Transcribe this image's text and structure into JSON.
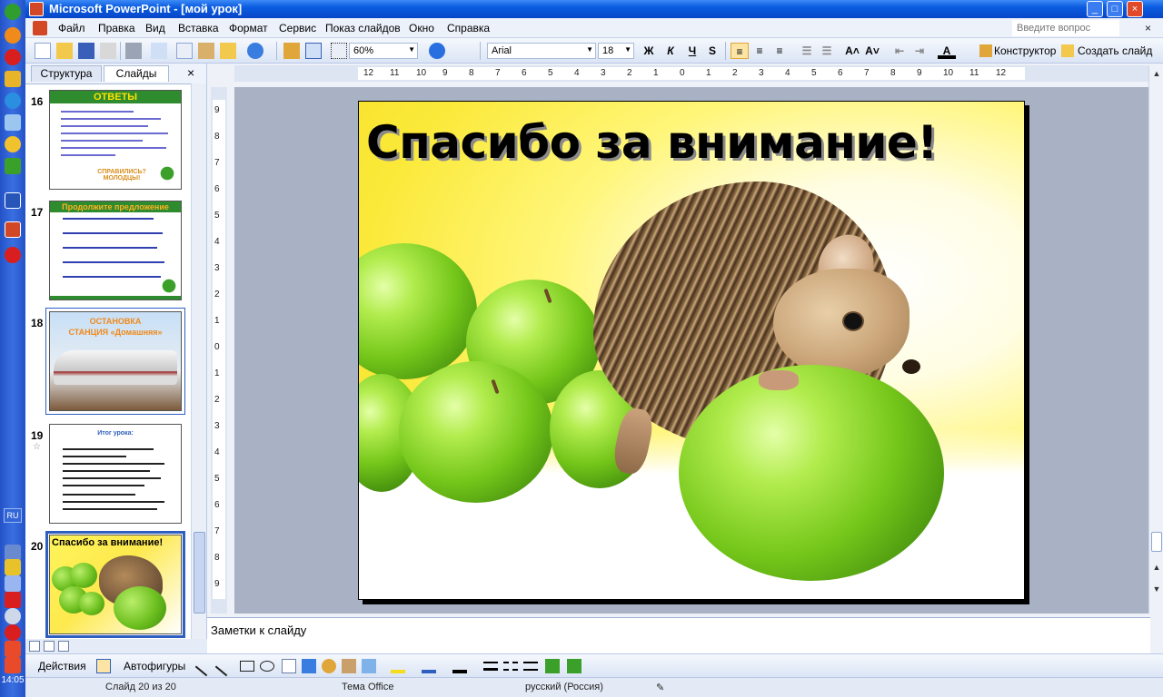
{
  "window": {
    "title": "Microsoft PowerPoint - [мой урок]",
    "minimize": "_",
    "maximize": "□",
    "close": "×"
  },
  "menu": {
    "items": [
      "Файл",
      "Правка",
      "Вид",
      "Вставка",
      "Формат",
      "Сервис",
      "Показ слайдов",
      "Окно",
      "Справка"
    ],
    "help_placeholder": "Введите вопрос",
    "doc_close": "×"
  },
  "toolbar": {
    "zoom": "60%",
    "font": "Arial",
    "size": "18",
    "bold": "Ж",
    "italic": "К",
    "underline": "Ч",
    "shadow": "S",
    "increase_font": "A˄",
    "decrease_font": "A˅",
    "font_color": "A",
    "designer": "Конструктор",
    "new_slide": "Создать слайд"
  },
  "panel": {
    "tabs": [
      "Структура",
      "Слайды"
    ],
    "close": "×",
    "slides": [
      {
        "number": "16",
        "title": "ОТВЕТЫ",
        "footer": "СПРАВИЛИСЬ? МОЛОДЦЫ!"
      },
      {
        "number": "17",
        "title": "Продолжите предложение"
      },
      {
        "number": "18",
        "title": "ОСТАНОВКА",
        "subtitle": "СТАНЦИЯ «Домашняя»"
      },
      {
        "number": "19",
        "title": "Итог урока:"
      },
      {
        "number": "20",
        "title": "Спасибо за внимание!"
      }
    ]
  },
  "ruler": {
    "h_ticks": [
      "12",
      "11",
      "10",
      "9",
      "8",
      "7",
      "6",
      "5",
      "4",
      "3",
      "2",
      "1",
      "0",
      "1",
      "2",
      "3",
      "4",
      "5",
      "6",
      "7",
      "8",
      "9",
      "10",
      "11",
      "12"
    ],
    "v_ticks": [
      "9",
      "8",
      "7",
      "6",
      "5",
      "4",
      "3",
      "2",
      "1",
      "0",
      "1",
      "2",
      "3",
      "4",
      "5",
      "6",
      "7",
      "8",
      "9"
    ]
  },
  "slide": {
    "title": "Спасибо за внимание!"
  },
  "notes": {
    "placeholder": "Заметки к слайду"
  },
  "drawing": {
    "actions": "Действия",
    "autoshapes": "Автофигуры"
  },
  "status": {
    "slide": "Слайд 20 из 20",
    "theme": "Тема Office",
    "language": "русский (Россия)"
  },
  "taskbar": {
    "lang": "RU",
    "clock": "14:05"
  }
}
